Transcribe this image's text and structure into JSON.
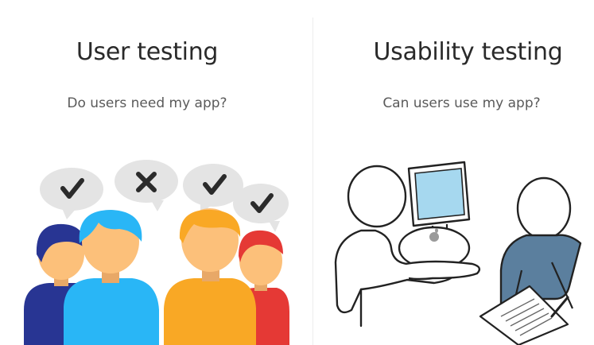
{
  "left_panel": {
    "title": "User testing",
    "subtitle": "Do users need my app?",
    "illustration": {
      "icon_names": [
        "checkmark-icon",
        "cross-icon",
        "checkmark-icon",
        "checkmark-icon"
      ],
      "colors": {
        "bubble": "#e4e4e4",
        "mark": "#2b2b2b",
        "navy": "#283593",
        "sky_blue": "#29b6f6",
        "orange": "#f9a825",
        "red": "#e53935",
        "skin": "#fcc07a"
      }
    }
  },
  "right_panel": {
    "title": "Usability testing",
    "subtitle": "Can users use my app?",
    "illustration": {
      "icon_names": [
        "computer-icon",
        "apple-logo-icon",
        "document-icon",
        "pen-icon"
      ],
      "colors": {
        "screen": "#a6d8ef",
        "shirt": "#5b7f9e",
        "outline": "#222222"
      }
    }
  }
}
